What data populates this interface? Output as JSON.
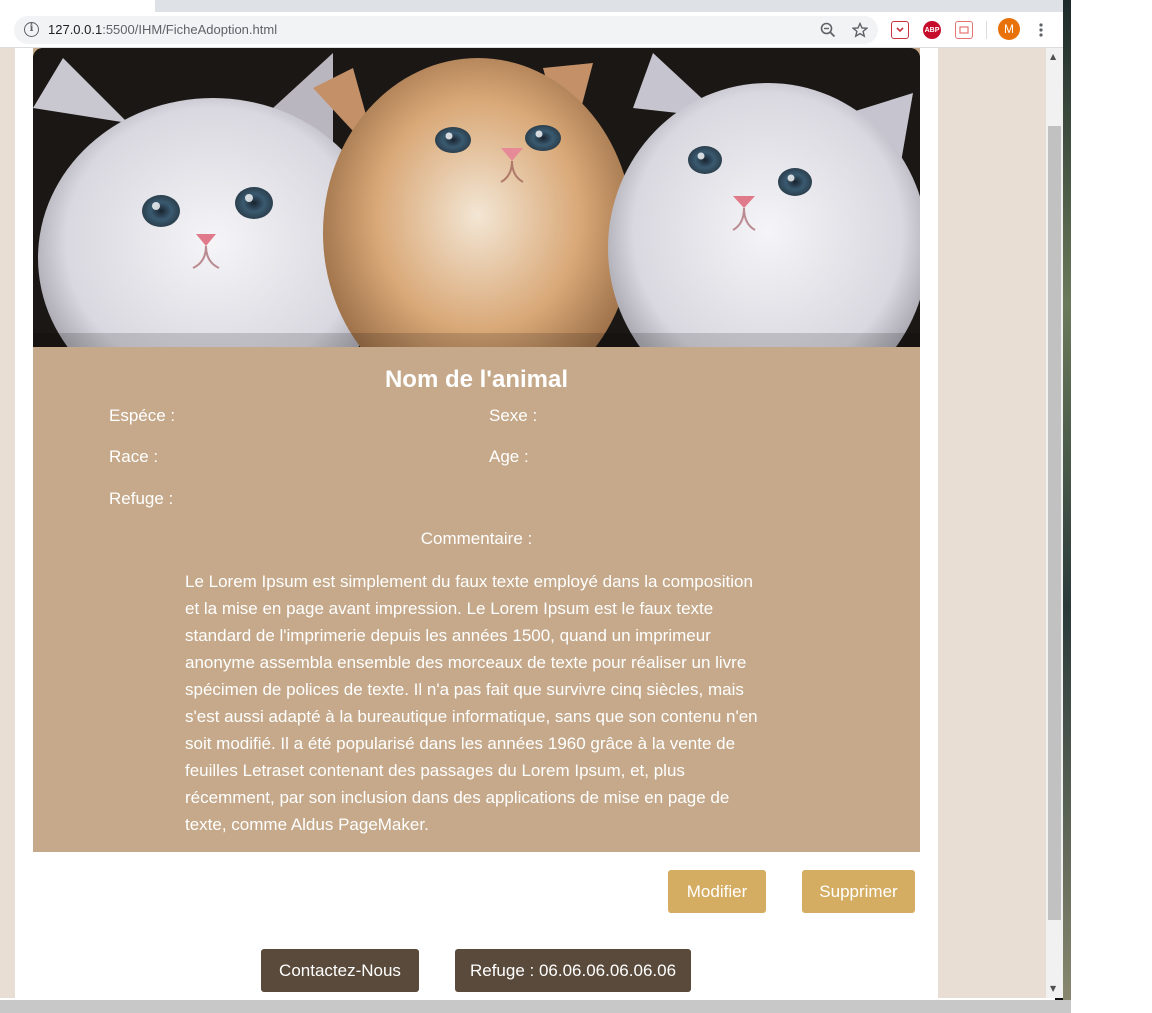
{
  "browser": {
    "url_host": "127.0.0.1",
    "url_path": ":5500/IHM/FicheAdoption.html",
    "avatar_letter": "M",
    "extensions": [
      {
        "name": "pocket-extension",
        "label": "",
        "color": "#c8353e"
      },
      {
        "name": "adblock-plus-extension",
        "label": "ABP",
        "color": "#c70d2c"
      },
      {
        "name": "extension-icon-3",
        "label": "",
        "color": "#e57373"
      }
    ]
  },
  "animal": {
    "name": "Nom de l'animal",
    "species_label": "Espéce :",
    "sex_label": "Sexe :",
    "breed_label": "Race :",
    "age_label": "Age :",
    "shelter_label": "Refuge :",
    "comment_label": "Commentaire :",
    "comment_text": "Le Lorem Ipsum est simplement du faux texte employé dans la composition et la mise en page avant impression. Le Lorem Ipsum est le faux texte standard de l'imprimerie depuis les années 1500, quand un imprimeur anonyme assembla ensemble des morceaux de texte pour réaliser un livre spécimen de polices de texte. Il n'a pas fait que survivre cinq siècles, mais s'est aussi adapté à la bureautique informatique, sans que son contenu n'en soit modifié. Il a été popularisé dans les années 1960 grâce à la vente de feuilles Letraset contenant des passages du Lorem Ipsum, et, plus récemment, par son inclusion dans des applications de mise en page de texte, comme Aldus PageMaker."
  },
  "actions": {
    "edit_label": "Modifier",
    "delete_label": "Supprimer"
  },
  "footer": {
    "contact_label": "Contactez-Nous",
    "shelter_phone_label": "Refuge : 06.06.06.06.06.06"
  },
  "colors": {
    "card_bg": "#c5a98a",
    "gold_button": "#d4ad62",
    "dark_button": "#5a4a3b",
    "page_side": "#e9ded4"
  }
}
